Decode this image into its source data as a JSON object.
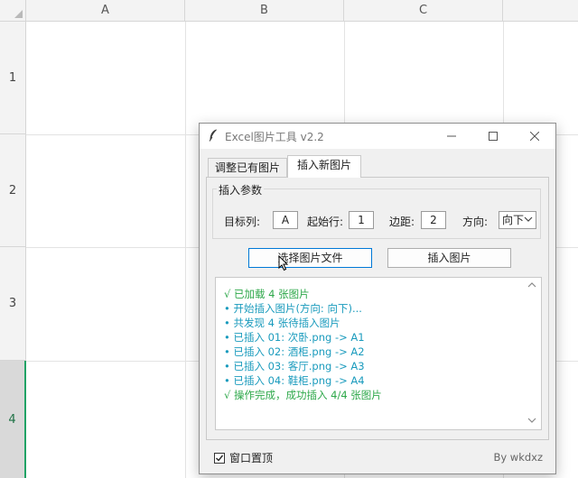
{
  "spreadsheet": {
    "columns": [
      "A",
      "B",
      "C"
    ],
    "rows": [
      "1",
      "2",
      "3",
      "4"
    ],
    "selected_row": "4",
    "accent_color": "#21a366"
  },
  "dialog": {
    "title": "Excel图片工具 v2.2",
    "icon": "feather-icon",
    "window_buttons": [
      "minimize-icon",
      "maximize-icon",
      "close-icon"
    ],
    "tabs": [
      {
        "label": "调整已有图片",
        "active": false
      },
      {
        "label": "插入新图片",
        "active": true
      }
    ],
    "params": {
      "title": "插入参数",
      "target_col_label": "目标列:",
      "target_col_value": "A",
      "start_row_label": "起始行:",
      "start_row_value": "1",
      "margin_label": "边距:",
      "margin_value": "2",
      "direction_label": "方向:",
      "direction_value": "向下"
    },
    "buttons": {
      "select_files": "选择图片文件",
      "insert_images": "插入图片"
    },
    "log": [
      {
        "text": "√ 已加载 4 张图片",
        "color": "#2ea84a"
      },
      {
        "text": "• 开始插入图片(方向: 向下)...",
        "color": "#1a9bbd"
      },
      {
        "text": "• 共发现 4 张待插入图片",
        "color": "#1a9bbd"
      },
      {
        "text": "• 已插入 01: 次卧.png -> A1",
        "color": "#1a9bbd"
      },
      {
        "text": "• 已插入 02: 酒柜.png -> A2",
        "color": "#1a9bbd"
      },
      {
        "text": "• 已插入 03: 客厅.png -> A3",
        "color": "#1a9bbd"
      },
      {
        "text": "• 已插入 04: 鞋柜.png -> A4",
        "color": "#1a9bbd"
      },
      {
        "text": "√ 操作完成，成功插入 4/4 张图片",
        "color": "#2ea84a"
      }
    ],
    "topmost_label": "窗口置顶",
    "topmost_checked": true,
    "credit": "By wkdxz"
  }
}
